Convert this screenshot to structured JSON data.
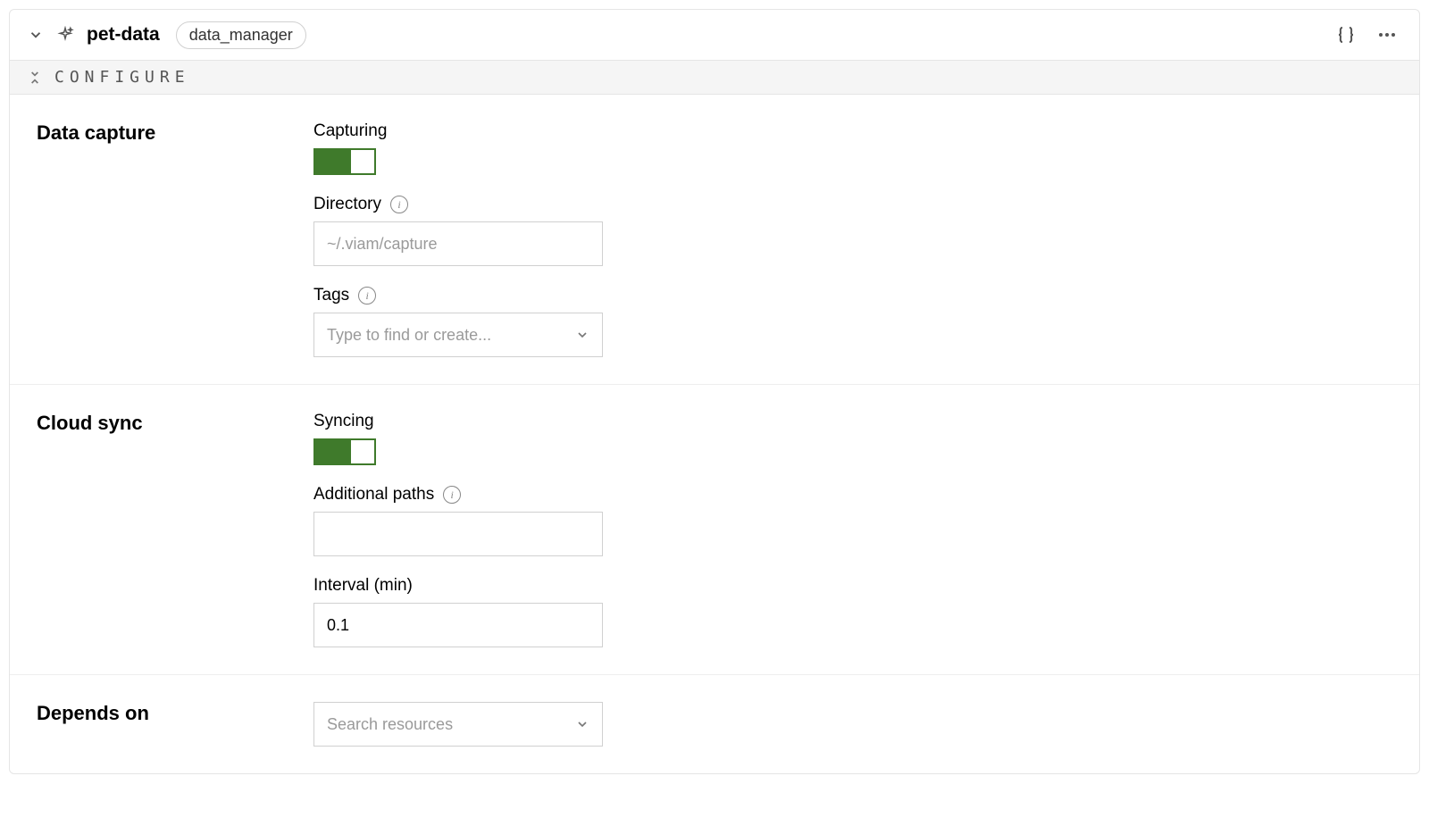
{
  "header": {
    "title": "pet-data",
    "chip": "data_manager"
  },
  "configure_bar": {
    "label": "CONFIGURE"
  },
  "sections": {
    "data_capture": {
      "title": "Data capture",
      "capturing_label": "Capturing",
      "capturing_on": true,
      "directory_label": "Directory",
      "directory_placeholder": "~/.viam/capture",
      "directory_value": "",
      "tags_label": "Tags",
      "tags_placeholder": "Type to find or create..."
    },
    "cloud_sync": {
      "title": "Cloud sync",
      "syncing_label": "Syncing",
      "syncing_on": true,
      "additional_paths_label": "Additional paths",
      "additional_paths_value": "",
      "interval_label": "Interval (min)",
      "interval_value": "0.1"
    },
    "depends_on": {
      "title": "Depends on",
      "placeholder": "Search resources"
    }
  }
}
